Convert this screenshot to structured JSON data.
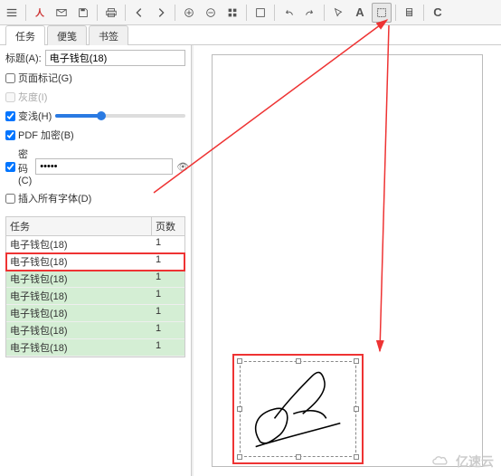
{
  "toolbar": {
    "icons": [
      "menu",
      "pdf",
      "mail",
      "save",
      "print",
      "back",
      "forward",
      "zoom-in",
      "zoom-out",
      "grid",
      "fit",
      "undo",
      "redo",
      "pointer",
      "text",
      "select",
      "copy",
      "refresh"
    ]
  },
  "tabs": {
    "items": [
      "任务",
      "便笺",
      "书签"
    ],
    "active": 0
  },
  "panel": {
    "title_label": "标题(A):",
    "title_value": "电子钱包(18)",
    "page_mark": "页面标记(G)",
    "gray": "灰度(I)",
    "fade": "变浅(H)",
    "pdf_encrypt": "PDF 加密(B)",
    "password_label": "密码(C)",
    "password_value": "●●●●●",
    "insert_fonts": "插入所有字体(D)"
  },
  "task_table": {
    "headers": {
      "name": "任务",
      "pages": "页数"
    },
    "rows": [
      {
        "name": "电子钱包(18)",
        "pages": "1",
        "state": ""
      },
      {
        "name": "电子钱包(18)",
        "pages": "1",
        "state": "sel"
      },
      {
        "name": "电子钱包(18)",
        "pages": "1",
        "state": "green"
      },
      {
        "name": "电子钱包(18)",
        "pages": "1",
        "state": "green"
      },
      {
        "name": "电子钱包(18)",
        "pages": "1",
        "state": "green"
      },
      {
        "name": "电子钱包(18)",
        "pages": "1",
        "state": "green"
      },
      {
        "name": "电子钱包(18)",
        "pages": "1",
        "state": "green"
      }
    ]
  },
  "watermark": "亿速云"
}
